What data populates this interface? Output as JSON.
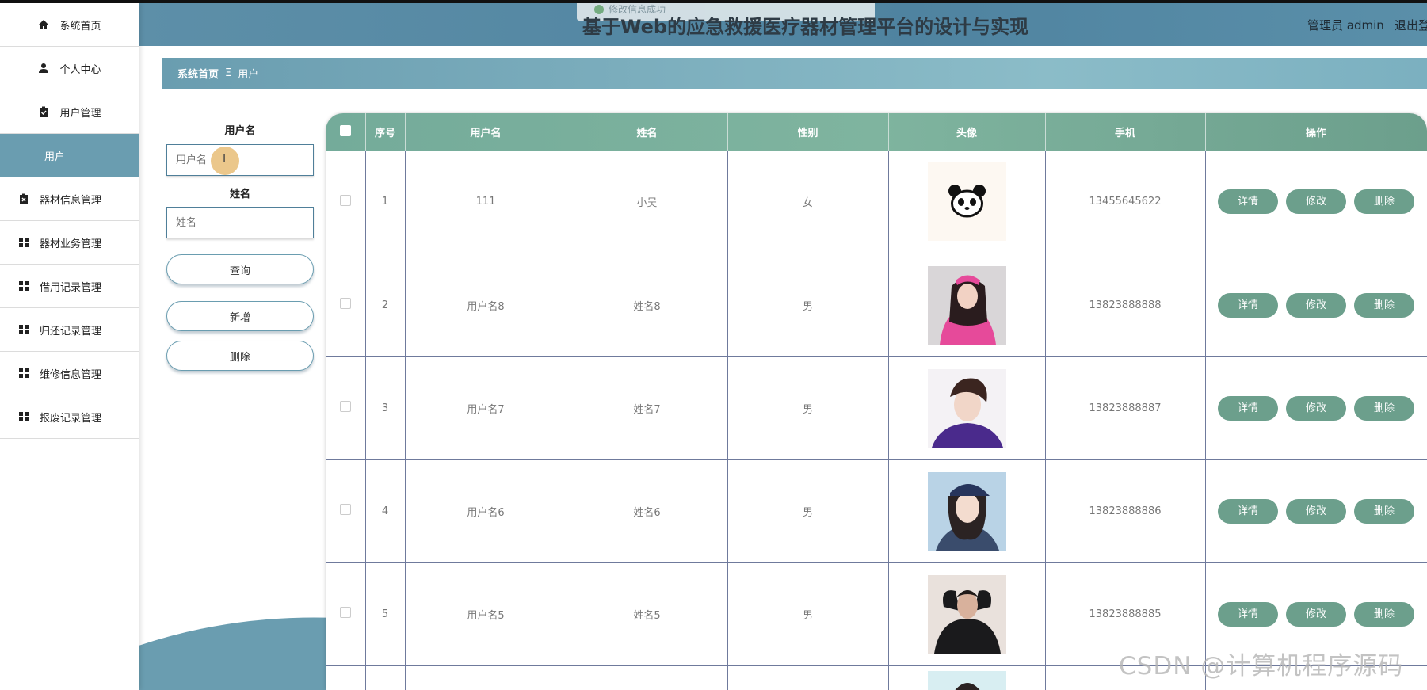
{
  "header": {
    "title": "基于Web的应急救援医疗器材管理平台的设计与实现",
    "user": "管理员 admin",
    "logout": "退出登",
    "toast": "修改信息成功"
  },
  "sidebar": {
    "items": [
      {
        "label": "系统首页",
        "icon": "home-icon"
      },
      {
        "label": "个人中心",
        "icon": "person-icon"
      },
      {
        "label": "用户管理",
        "icon": "clipboard-icon"
      },
      {
        "label": "用户",
        "icon": ""
      },
      {
        "label": "器材信息管理",
        "icon": "clipboard-x-icon"
      },
      {
        "label": "器材业务管理",
        "icon": "grid-icon"
      },
      {
        "label": "借用记录管理",
        "icon": "grid-icon"
      },
      {
        "label": "归还记录管理",
        "icon": "grid-icon"
      },
      {
        "label": "维修信息管理",
        "icon": "grid-icon"
      },
      {
        "label": "报废记录管理",
        "icon": "grid-icon"
      }
    ]
  },
  "breadcrumb": {
    "home": "系统首页",
    "sep": "Ξ",
    "current": "用户"
  },
  "search": {
    "username_label": "用户名",
    "username_placeholder": "用户名",
    "name_label": "姓名",
    "name_placeholder": "姓名",
    "query_button": "查询",
    "add_button": "新增",
    "delete_button": "删除"
  },
  "table": {
    "columns": [
      "",
      "序号",
      "用户名",
      "姓名",
      "性别",
      "头像",
      "手机",
      "操作"
    ],
    "actions": {
      "detail": "详情",
      "edit": "修改",
      "delete": "删除"
    },
    "rows": [
      {
        "index": "1",
        "username": "111",
        "name": "小吴",
        "gender": "女",
        "avatar": "panda",
        "phone": "13455645622"
      },
      {
        "index": "2",
        "username": "用户名8",
        "name": "姓名8",
        "gender": "男",
        "avatar": "photo-pink",
        "phone": "13823888888"
      },
      {
        "index": "3",
        "username": "用户名7",
        "name": "姓名7",
        "gender": "男",
        "avatar": "photo-purple",
        "phone": "13823888887"
      },
      {
        "index": "4",
        "username": "用户名6",
        "name": "姓名6",
        "gender": "男",
        "avatar": "photo-blue",
        "phone": "13823888886"
      },
      {
        "index": "5",
        "username": "用户名5",
        "name": "姓名5",
        "gender": "男",
        "avatar": "photo-black",
        "phone": "13823888885"
      }
    ]
  },
  "watermark": "CSDN @计算机程序源码",
  "colors": {
    "primary": "#6a9db0",
    "table_header": "#74ab9a",
    "op_button": "#6c9f8c"
  }
}
